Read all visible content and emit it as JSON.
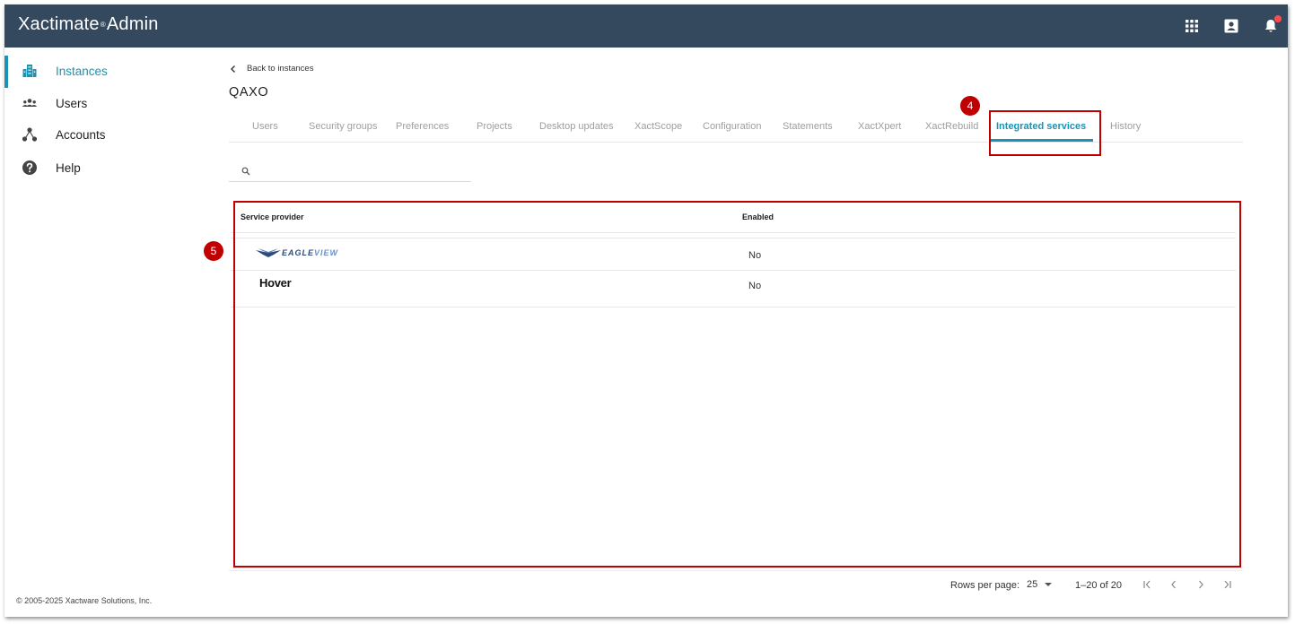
{
  "app": {
    "title": "Xactimate",
    "title_mark": "®",
    "title_suffix": "Admin"
  },
  "topbar_icons": [
    "apps-grid-icon",
    "contact-card-icon",
    "notification-bell-icon"
  ],
  "sidebar": {
    "items": [
      {
        "label": "Instances",
        "icon": "building-icon",
        "active": true
      },
      {
        "label": "Users",
        "icon": "users-group-icon",
        "active": false
      },
      {
        "label": "Accounts",
        "icon": "hierarchy-icon",
        "active": false
      },
      {
        "label": "Help",
        "icon": "help-circle-icon",
        "active": false
      }
    ],
    "footer": "© 2005-2025 Xactware Solutions, Inc."
  },
  "main": {
    "back_label": "Back to instances",
    "title": "QAXO",
    "tabs": [
      {
        "label": "Users"
      },
      {
        "label": "Security groups"
      },
      {
        "label": "Preferences"
      },
      {
        "label": "Projects"
      },
      {
        "label": "Desktop updates"
      },
      {
        "label": "XactScope"
      },
      {
        "label": "Configuration"
      },
      {
        "label": "Statements"
      },
      {
        "label": "XactXpert"
      },
      {
        "label": "XactRebuild"
      },
      {
        "label": "Integrated services",
        "active": true
      },
      {
        "label": "History"
      }
    ],
    "search": {
      "placeholder": "",
      "value": ""
    },
    "table": {
      "headers": {
        "provider": "Service provider",
        "enabled": "Enabled"
      },
      "rows": [
        {
          "provider_logo": "EAGLEVIEW",
          "logo_part1": "EAGLE",
          "logo_part2": "VIEW",
          "enabled": "No"
        },
        {
          "provider_logo": "Hover",
          "enabled": "No"
        }
      ]
    },
    "pagination": {
      "rows_per_page_label": "Rows per page:",
      "rows_per_page": "25",
      "range": "1–20 of 20"
    }
  },
  "annotations": {
    "tab_callout": "4",
    "table_callout": "5",
    "highlight_color": "#c00000"
  },
  "colors": {
    "topbar": "#34495e",
    "accent": "#1a94b4"
  }
}
